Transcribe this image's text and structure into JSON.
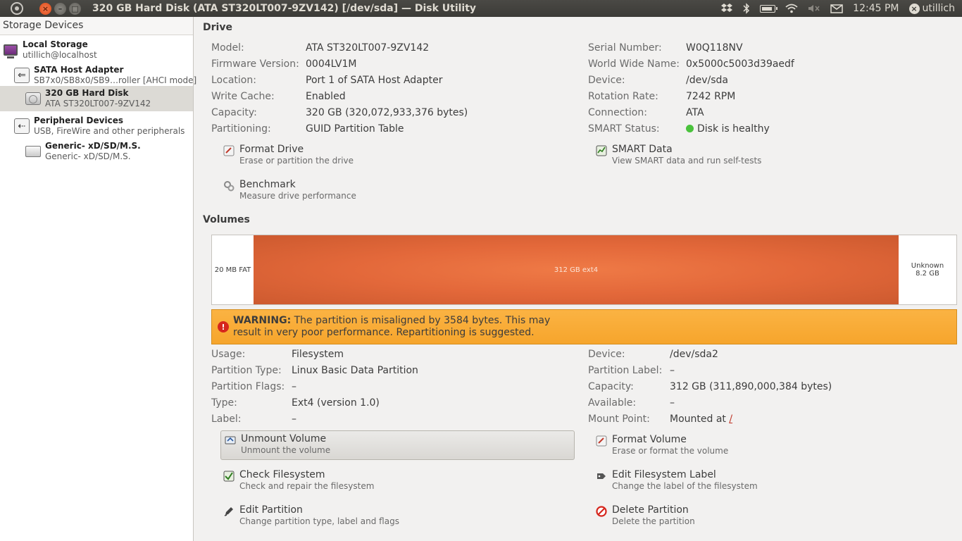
{
  "topbar": {
    "title": "320 GB Hard Disk (ATA ST320LT007-9ZV142) [/dev/sda] — Disk Utility",
    "clock": "12:45 PM",
    "user": "utillich",
    "close_glyph": "×",
    "min_glyph": "–",
    "max_glyph": "□",
    "icons": [
      "ubuntu-logo-icon",
      "dropbox-icon",
      "bluetooth-icon",
      "battery-icon",
      "wifi-icon",
      "volume-muted-icon",
      "mail-icon",
      "user-icon"
    ]
  },
  "sidebar": {
    "header": "Storage Devices",
    "items": [
      {
        "title": "Local Storage",
        "subtitle": "utillich@localhost",
        "icon": "computer-icon"
      },
      {
        "title": "SATA Host Adapter",
        "subtitle": "SB7x0/SB8x0/SB9…roller [AHCI mode]",
        "icon": "adapter-icon"
      },
      {
        "title": "320 GB Hard Disk",
        "subtitle": "ATA ST320LT007-9ZV142",
        "icon": "hard-disk-icon",
        "selected": true
      },
      {
        "title": "Peripheral Devices",
        "subtitle": "USB, FireWire and other peripherals",
        "icon": "usb-icon"
      },
      {
        "title": "Generic- xD/SD/M.S.",
        "subtitle": "Generic- xD/SD/M.S.",
        "icon": "card-reader-icon"
      }
    ]
  },
  "drive": {
    "title": "Drive",
    "left": [
      {
        "key": "Model:",
        "value": "ATA ST320LT007-9ZV142"
      },
      {
        "key": "Firmware Version:",
        "value": "0004LV1M"
      },
      {
        "key": "Location:",
        "value": "Port 1 of SATA Host Adapter"
      },
      {
        "key": "Write Cache:",
        "value": "Enabled"
      },
      {
        "key": "Capacity:",
        "value": "320 GB (320,072,933,376 bytes)"
      },
      {
        "key": "Partitioning:",
        "value": "GUID Partition Table"
      }
    ],
    "right": [
      {
        "key": "Serial Number:",
        "value": "W0Q118NV"
      },
      {
        "key": "World Wide Name:",
        "value": "0x5000c5003d39aedf"
      },
      {
        "key": "Device:",
        "value": "/dev/sda"
      },
      {
        "key": "Rotation Rate:",
        "value": "7242 RPM"
      },
      {
        "key": "Connection:",
        "value": "ATA"
      },
      {
        "key": "SMART Status:",
        "value": "Disk is healthy",
        "status_color": "#4ac23c"
      }
    ],
    "actions": [
      {
        "label": "Format Drive",
        "desc": "Erase or partition the drive",
        "icon": "format-icon"
      },
      {
        "label": "SMART Data",
        "desc": "View SMART data and run self-tests",
        "icon": "smart-icon"
      },
      {
        "label": "Benchmark",
        "desc": "Measure drive performance",
        "icon": "benchmark-icon"
      }
    ]
  },
  "volumes": {
    "title": "Volumes",
    "segments": [
      {
        "label": "20 MB FAT"
      },
      {
        "label": "312 GB ext4",
        "color": "#e3683a"
      },
      {
        "label_line1": "Unknown",
        "label_line2": "8.2 GB"
      }
    ],
    "warning": {
      "bold": "WARNING:",
      "text": "The partition is misaligned by 3584 bytes. This may result in very poor performance. Repartitioning is suggested.",
      "color": "#f6a52c"
    },
    "left": [
      {
        "key": "Usage:",
        "value": "Filesystem"
      },
      {
        "key": "Partition Type:",
        "value": "Linux Basic Data Partition"
      },
      {
        "key": "Partition Flags:",
        "value": "–"
      },
      {
        "key": "Type:",
        "value": "Ext4 (version 1.0)"
      },
      {
        "key": "Label:",
        "value": "–"
      }
    ],
    "right": [
      {
        "key": "Device:",
        "value": "/dev/sda2"
      },
      {
        "key": "Partition Label:",
        "value": "–"
      },
      {
        "key": "Capacity:",
        "value": "312 GB (311,890,000,384 bytes)"
      },
      {
        "key": "Available:",
        "value": "–"
      },
      {
        "key": "Mount Point:",
        "value": "Mounted at ",
        "link": "/"
      }
    ],
    "actions": [
      {
        "label": "Unmount Volume",
        "desc": "Unmount the volume",
        "icon": "unmount-icon"
      },
      {
        "label": "Format Volume",
        "desc": "Erase or format the volume",
        "icon": "format-icon"
      },
      {
        "label": "Check Filesystem",
        "desc": "Check and repair the filesystem",
        "icon": "check-icon"
      },
      {
        "label": "Edit Filesystem Label",
        "desc": "Change the label of the filesystem",
        "icon": "label-icon"
      },
      {
        "label": "Edit Partition",
        "desc": "Change partition type, label and flags",
        "icon": "edit-icon"
      },
      {
        "label": "Delete Partition",
        "desc": "Delete the partition",
        "icon": "delete-icon"
      }
    ]
  }
}
